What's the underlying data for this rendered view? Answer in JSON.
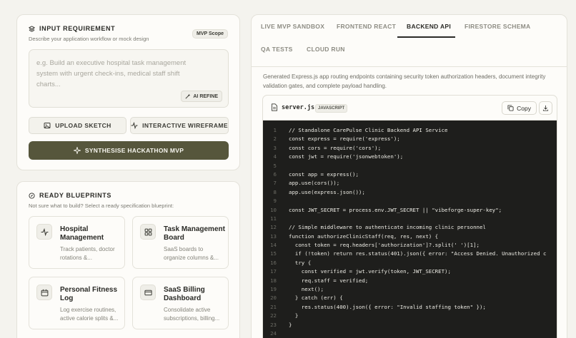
{
  "input_panel": {
    "title": "INPUT REQUIREMENT",
    "subtitle": "Describe your application workflow or mock design",
    "badge": "MVP Scope",
    "placeholder": "e.g. Build an executive hospital task management system with urgent check-ins, medical staff shift charts...",
    "ai_refine": "AI REFINE",
    "upload_label": "UPLOAD SKETCH",
    "wireframe_label": "INTERACTIVE WIREFRAME",
    "synthesise_label": "SYNTHESISE HACKATHON MVP"
  },
  "blueprints_panel": {
    "title": "READY BLUEPRINTS",
    "subtitle": "Not sure what to build? Select a ready specification blueprint:",
    "items": [
      {
        "title": "Hospital Management",
        "desc": "Track patients, doctor rotations &...",
        "icon": "pulse-icon"
      },
      {
        "title": "Task Management Board",
        "desc": "SaaS boards to organize columns &...",
        "icon": "grid-icon"
      },
      {
        "title": "Personal Fitness Log",
        "desc": "Log exercise routines, active calorie splits &...",
        "icon": "calendar-icon"
      },
      {
        "title": "SaaS Billing Dashboard",
        "desc": "Consolidate active subscriptions, billing...",
        "icon": "card-icon"
      }
    ]
  },
  "tabs": [
    "LIVE MVP SANDBOX",
    "FRONTEND REACT",
    "BACKEND API",
    "FIRESTORE SCHEMA",
    "QA TESTS",
    "CLOUD RUN"
  ],
  "active_tab": "BACKEND API",
  "description": "Generated Express.js app routing endpoints containing security token authorization headers, document integrity validation gates, and complete payload handling.",
  "editor": {
    "filename": "server.js",
    "language": "JAVASCRIPT",
    "copy_label": "Copy",
    "lines": [
      {
        "n": "1",
        "code": "// Standalone CarePulse Clinic Backend API Service"
      },
      {
        "n": "2",
        "code": "const express = require('express');"
      },
      {
        "n": "3",
        "code": "const cors = require('cors');"
      },
      {
        "n": "4",
        "code": "const jwt = require('jsonwebtoken');"
      },
      {
        "n": "5",
        "code": ""
      },
      {
        "n": "6",
        "code": "const app = express();"
      },
      {
        "n": "7",
        "code": "app.use(cors());"
      },
      {
        "n": "8",
        "code": "app.use(express.json());"
      },
      {
        "n": "9",
        "code": ""
      },
      {
        "n": "10",
        "code": "const JWT_SECRET = process.env.JWT_SECRET || \"vibeforge-super-key\";"
      },
      {
        "n": "11",
        "code": ""
      },
      {
        "n": "12",
        "code": "// Simple middleware to authenticate incoming clinic personnel"
      },
      {
        "n": "13",
        "code": "function authorizeClinicStaff(req, res, next) {"
      },
      {
        "n": "14",
        "code": "  const token = req.headers['authorization']?.split(' ')[1];"
      },
      {
        "n": "15",
        "code": "  if (!token) return res.status(401).json({ error: \"Access Denied. Unauthorized c"
      },
      {
        "n": "16",
        "code": "  try {"
      },
      {
        "n": "17",
        "code": "    const verified = jwt.verify(token, JWT_SECRET);"
      },
      {
        "n": "18",
        "code": "    req.staff = verified;"
      },
      {
        "n": "19",
        "code": "    next();"
      },
      {
        "n": "20",
        "code": "  } catch (err) {"
      },
      {
        "n": "21",
        "code": "    res.status(400).json({ error: \"Invalid staffing token\" });"
      },
      {
        "n": "22",
        "code": "  }"
      },
      {
        "n": "23",
        "code": "}"
      },
      {
        "n": "24",
        "code": ""
      }
    ]
  },
  "colors": {
    "primary_button": "#56563c",
    "code_bg": "#1e1e1c",
    "page_bg": "#f4f3ee"
  }
}
